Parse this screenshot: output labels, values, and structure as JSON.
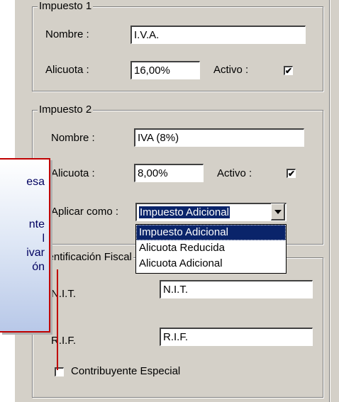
{
  "impuesto1": {
    "legend": "Impuesto 1",
    "nombre_label": "Nombre :",
    "nombre_value": "I.V.A.",
    "alicuota_label": "Alicuota :",
    "alicuota_value": "16,00%",
    "activo_label": "Activo :",
    "activo_checked": "✔"
  },
  "impuesto2": {
    "legend": "Impuesto 2",
    "nombre_label": "Nombre :",
    "nombre_value": "IVA (8%)",
    "alicuota_label": "Alicuota :",
    "alicuota_value": "8,00%",
    "activo_label": "Activo :",
    "activo_checked": "✔",
    "aplicar_label": "Aplicar como :",
    "aplicar_value": "Impuesto Adicional",
    "options": [
      "Impuesto Adicional",
      "Alicuota Reducida",
      "Alicuota Adicional"
    ]
  },
  "fiscal": {
    "legend": "Identificación Fiscal",
    "nit_label": "N.I.T.",
    "nit_value": "N.I.T.",
    "rif_label": "R.I.F.",
    "rif_value": "R.I.F.",
    "contribuyente_label": "Contribuyente Especial"
  },
  "callout": {
    "lines": [
      "esa",
      "",
      "nte",
      "l",
      "ivar",
      "ón"
    ]
  },
  "colors": {
    "callout_border": "#c00000",
    "selection": "#0a246a"
  }
}
